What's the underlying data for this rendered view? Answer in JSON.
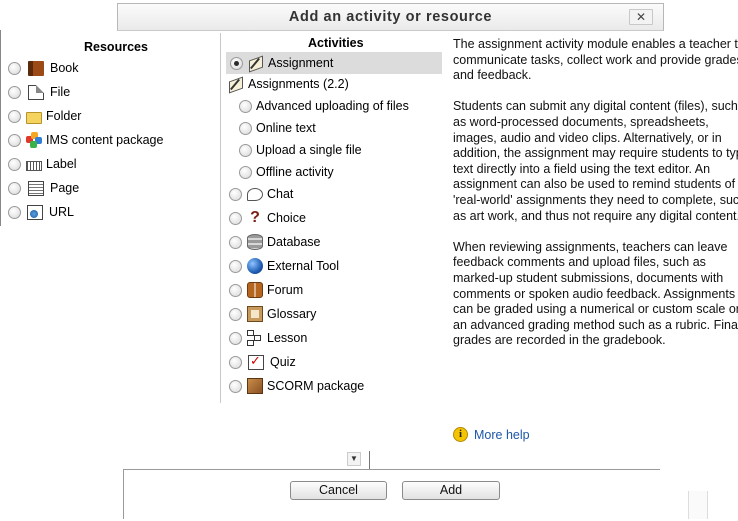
{
  "dialog": {
    "title": "Add an activity or resource",
    "close_label": "✕"
  },
  "resources": {
    "heading": "Resources",
    "items": [
      {
        "label": "Book",
        "icon": "book-icon"
      },
      {
        "label": "File",
        "icon": "file-icon"
      },
      {
        "label": "Folder",
        "icon": "folder-icon"
      },
      {
        "label": "IMS content package",
        "icon": "ims-package-icon"
      },
      {
        "label": "Label",
        "icon": "label-icon"
      },
      {
        "label": "Page",
        "icon": "page-icon"
      },
      {
        "label": "URL",
        "icon": "url-icon"
      }
    ]
  },
  "activities": {
    "heading": "Activities",
    "selected": "Assignment",
    "assignment": {
      "label": "Assignment",
      "icon": "assignment-icon"
    },
    "assignments_group": {
      "label": "Assignments (2.2)",
      "icon": "assignment-icon"
    },
    "sub_items": [
      {
        "label": "Advanced uploading of files"
      },
      {
        "label": "Online text"
      },
      {
        "label": "Upload a single file"
      },
      {
        "label": "Offline activity"
      }
    ],
    "items": [
      {
        "label": "Chat",
        "icon": "chat-icon"
      },
      {
        "label": "Choice",
        "icon": "choice-icon"
      },
      {
        "label": "Database",
        "icon": "database-icon"
      },
      {
        "label": "External Tool",
        "icon": "external-tool-icon"
      },
      {
        "label": "Forum",
        "icon": "forum-icon"
      },
      {
        "label": "Glossary",
        "icon": "glossary-icon"
      },
      {
        "label": "Lesson",
        "icon": "lesson-icon"
      },
      {
        "label": "Quiz",
        "icon": "quiz-icon"
      },
      {
        "label": "SCORM package",
        "icon": "scorm-icon"
      }
    ]
  },
  "description": {
    "paragraphs": [
      "The assignment activity module enables a teacher to communicate tasks, collect work and provide grades and feedback.",
      "Students can submit any digital content (files), such as word-processed documents, spreadsheets, images, audio and video clips. Alternatively, or in addition, the assignment may require students to type text directly into a field using the text editor. An assignment can also be used to remind students of 'real-world' assignments they need to complete, such as art work, and thus not require any digital content.",
      "When reviewing assignments, teachers can leave feedback comments and upload files, such as marked-up student submissions, documents with comments or spoken audio feedback. Assignments can be graded using a numerical or custom scale or an advanced grading method such as a rubric. Final grades are recorded in the gradebook."
    ],
    "help_icon_glyph": "i",
    "more_help": "More help"
  },
  "footer": {
    "cancel": "Cancel",
    "add": "Add"
  },
  "scroll": {
    "arrow_glyph": "▼"
  },
  "colors": {
    "link": "#1c57a8",
    "selected_row": "#dcdcdc"
  }
}
